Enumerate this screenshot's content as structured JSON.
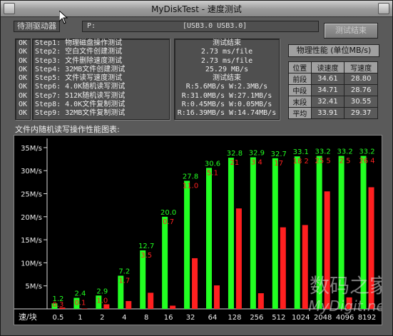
{
  "window": {
    "title": "MyDiskTest - 速度测试"
  },
  "drive": {
    "label": "待测驱动器",
    "letter": "P:",
    "name": "[USB3.0 USB3.0]"
  },
  "end_button": {
    "label": "测试结束"
  },
  "steps": [
    {
      "status": "OK",
      "label": "Step1: 物理磁盘操作测试"
    },
    {
      "status": "OK",
      "label": "Step2: 空白文件创建测试"
    },
    {
      "status": "OK",
      "label": "Step3: 文件删除速度测试"
    },
    {
      "status": "OK",
      "label": "Step4: 32MB文件创建测试"
    },
    {
      "status": "OK",
      "label": "Step5: 文件读写速度测试"
    },
    {
      "status": "OK",
      "label": "Step6: 4.0K随机读写测试"
    },
    {
      "status": "OK",
      "label": "Step7: 512K随机读写测试"
    },
    {
      "status": "OK",
      "label": "Step8: 4.0K文件复制测试"
    },
    {
      "status": "OK",
      "label": "Step9: 32MB文件复制测试"
    }
  ],
  "results": [
    "测试结束",
    "2.73 ms/file",
    "2.73 ms/file",
    "25.29 MB/s",
    "测试结束",
    "R:5.6MB/s W:2.3MB/s",
    "R:31.0MB/s W:27.1MB/s",
    "R:0.45MB/s W:0.05MB/s",
    "R:16.39MB/s W:14.74MB/s"
  ],
  "physical": {
    "title": "物理性能 (单位MB/s)",
    "headers": [
      "位置",
      "读速度",
      "写速度"
    ],
    "rows": [
      [
        "前段",
        "34.61",
        "28.80"
      ],
      [
        "中段",
        "34.71",
        "28.76"
      ],
      [
        "末段",
        "32.41",
        "30.55"
      ],
      [
        "平均",
        "33.91",
        "29.37"
      ]
    ]
  },
  "chart_title": "文件内随机读写操作性能图表:",
  "chart_data": {
    "type": "bar",
    "xlabel": "速/块",
    "categories": [
      "0.5",
      "1",
      "2",
      "4",
      "8",
      "16",
      "32",
      "64",
      "128",
      "256",
      "512",
      "1024",
      "2048",
      "4096",
      "8192"
    ],
    "ylim": [
      0,
      37
    ],
    "yticks": [
      "5M/s",
      "10M/s",
      "15M/s",
      "20M/s",
      "25M/s",
      "30M/s",
      "35M/s"
    ],
    "series": [
      {
        "color": "#22ff22",
        "values": [
          1.2,
          2.4,
          2.9,
          7.2,
          12.7,
          20.0,
          27.8,
          30.6,
          32.8,
          32.9,
          32.7,
          33.1,
          33.2,
          33.2,
          33.2
        ],
        "labels": [
          "1.2",
          "2.4",
          "2.9",
          "7.2",
          "12.7",
          "20.0",
          "27.8",
          "30.6",
          "32.8",
          "32.9",
          "32.7",
          "33.1",
          "33.2",
          "33.2",
          "33.2"
        ]
      },
      {
        "color": "#ff2020",
        "values": [
          0.3,
          0.1,
          1.0,
          1.7,
          3.5,
          0.7,
          11.0,
          5.1,
          21.8,
          3.4,
          17.7,
          18.2,
          25.5,
          2.5,
          26.4
        ],
        "labels": [
          "0.3",
          "0.1",
          "1.0",
          "1.7",
          "3.5",
          "0.7",
          "11.0",
          "5.1",
          "21",
          "3 4",
          "17",
          "18 2",
          "25 5",
          "2 5",
          "26 4"
        ]
      }
    ]
  },
  "watermark": "数码之家 MyDigit.net"
}
